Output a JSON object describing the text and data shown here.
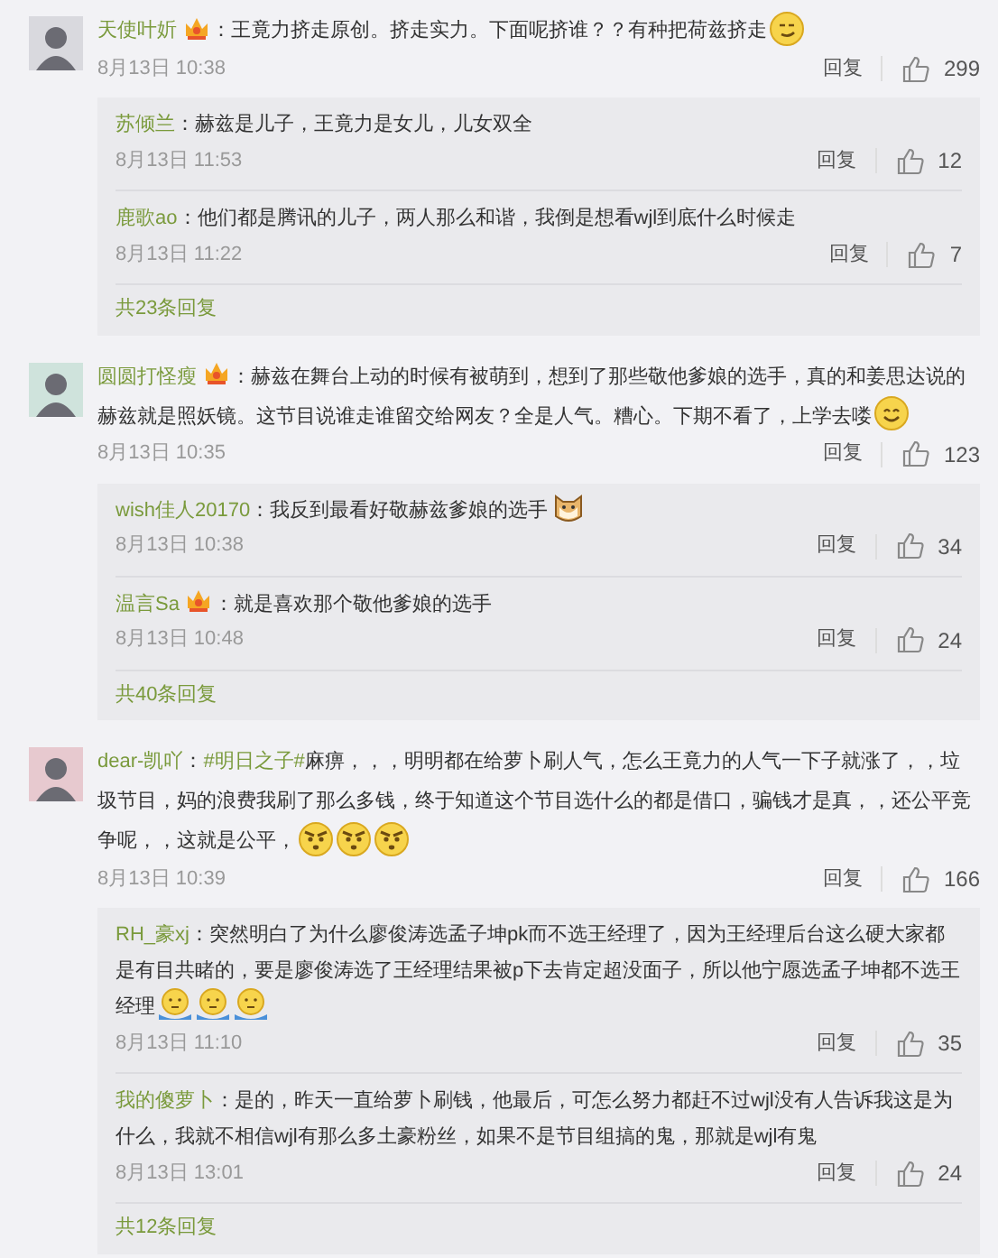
{
  "comments": [
    {
      "name": "天使叶妡",
      "vip": true,
      "text": "：王竟力挤走原创。挤走实力。下面呢挤谁？？有种把荷兹挤走",
      "emojis": [
        {
          "kind": "smirk"
        }
      ],
      "time": "8月13日 10:38",
      "reply": "回复",
      "likes": "299",
      "replies": [
        {
          "name": "苏倾兰",
          "vip": false,
          "text": "：赫兹是儿子，王竟力是女儿，儿女双全",
          "time": "8月13日 11:53",
          "reply": "回复",
          "likes": "12"
        },
        {
          "name": "鹿歌ao",
          "vip": false,
          "text": "：他们都是腾讯的儿子，两人那么和谐，我倒是想看wjl到底什么时候走",
          "time": "8月13日 11:22",
          "reply": "回复",
          "likes": "7"
        }
      ],
      "more": "共23条回复"
    },
    {
      "name": "圆圆打怪瘦",
      "vip": true,
      "text": "：赫兹在舞台上动的时候有被萌到，想到了那些敬他爹娘的选手，真的和姜思达说的赫兹就是照妖镜。这节目说谁走谁留交给网友？全是人气。糟心。下期不看了，上学去喽",
      "emojis": [
        {
          "kind": "smile"
        }
      ],
      "time": "8月13日 10:35",
      "reply": "回复",
      "likes": "123",
      "replies": [
        {
          "name": "wish佳人20170",
          "vip": false,
          "text": "：我反到最看好敬赫兹爹娘的选手",
          "emojis": [
            {
              "kind": "dog"
            }
          ],
          "time": "8月13日 10:38",
          "reply": "回复",
          "likes": "34"
        },
        {
          "name": "温言Sa",
          "vip": true,
          "text": "：就是喜欢那个敬他爹娘的选手",
          "time": "8月13日 10:48",
          "reply": "回复",
          "likes": "24"
        }
      ],
      "more": "共40条回复"
    },
    {
      "name": "dear-凯吖",
      "vip": false,
      "lead": "：",
      "topic": "#明日之子#",
      "text": "麻痹，，，明明都在给萝卜刷人气，怎么王竟力的人气一下子就涨了，，垃圾节目，妈的浪费我刷了那么多钱，终于知道这个节目选什么的都是借口，骗钱才是真，，还公平竞争呢，，这就是公平，",
      "emojis": [
        {
          "kind": "angry"
        },
        {
          "kind": "angry"
        },
        {
          "kind": "angry"
        }
      ],
      "time": "8月13日 10:39",
      "reply": "回复",
      "likes": "166",
      "replies": [
        {
          "name": "RH_豪xj",
          "vip": false,
          "text": "：突然明白了为什么廖俊涛选孟子坤pk而不选王经理了，因为王经理后台这么硬大家都是有目共睹的，要是廖俊涛选了王经理结果被p下去肯定超没面子，所以他宁愿选孟子坤都不选王经理",
          "emojis": [
            {
              "kind": "shrug"
            },
            {
              "kind": "shrug"
            },
            {
              "kind": "shrug"
            }
          ],
          "time": "8月13日 11:10",
          "reply": "回复",
          "likes": "35"
        },
        {
          "name": "我的傻萝卜",
          "vip": false,
          "text": "：是的，昨天一直给萝卜刷钱，他最后，可怎么努力都赶不过wjl没有人告诉我这是为什么，我就不相信wjl有那么多土豪粉丝，如果不是节目组搞的鬼，那就是wjl有鬼",
          "time": "8月13日 13:01",
          "reply": "回复",
          "likes": "24"
        }
      ],
      "more": "共12条回复"
    }
  ]
}
